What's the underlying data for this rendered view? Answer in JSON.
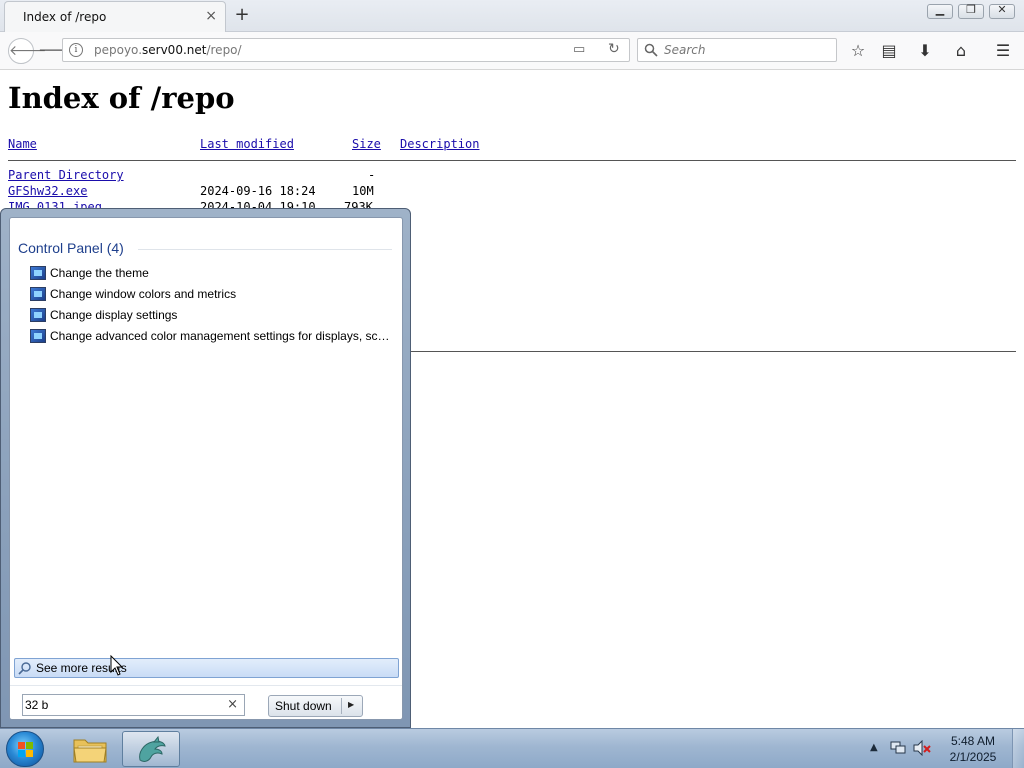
{
  "browser": {
    "tab_title": "Index of /repo",
    "tab_close": "×",
    "new_tab": "+",
    "url_host_prefix": "pepoyo.",
    "url_domain": "serv00.net",
    "url_path": "/repo/",
    "search_placeholder": "Search"
  },
  "page": {
    "heading": "Index of /repo",
    "columns": {
      "name": "Name",
      "modified": "Last modified",
      "size": "Size",
      "description": "Description"
    },
    "parent": {
      "name": "Parent Directory",
      "size": "-"
    },
    "rows": [
      {
        "name": "GFShw32.exe",
        "modified": "2024-09-16 18:24",
        "size": "10M"
      },
      {
        "name": "IMG_0131.jpeg",
        "modified": "2024-10-04 19:10",
        "size": "793K"
      }
    ]
  },
  "start_menu": {
    "group_title": "Control Panel (4)",
    "items": [
      {
        "label": "Change the theme"
      },
      {
        "label": "Change window colors and metrics"
      },
      {
        "label": "Change display settings"
      },
      {
        "label": "Change advanced color management settings for displays, sca..."
      }
    ],
    "see_more": "See more results",
    "search_value": "32 b",
    "clear": "×",
    "shutdown_label": "Shut down"
  },
  "taskbar": {
    "time": "5:48 AM",
    "date": "2/1/2025"
  }
}
